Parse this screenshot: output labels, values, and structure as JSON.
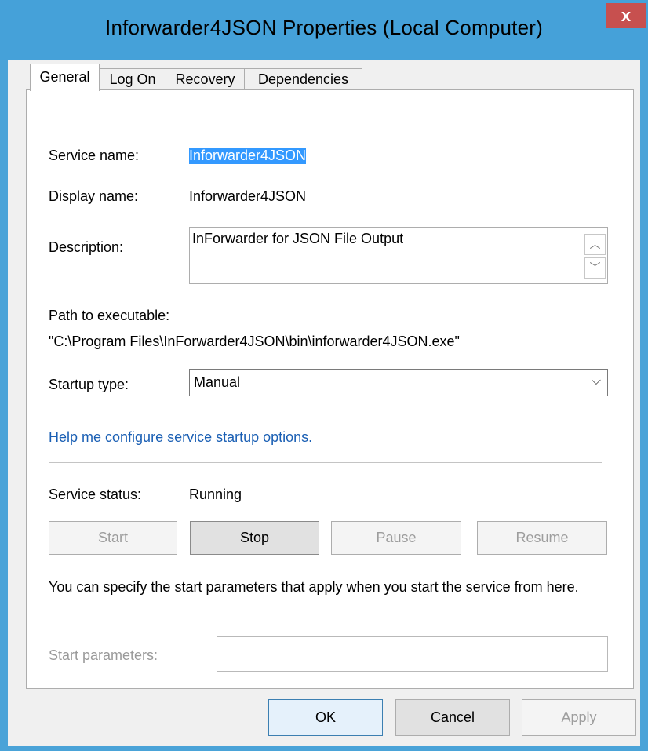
{
  "window": {
    "title": "Inforwarder4JSON Properties (Local Computer)",
    "close_label": "x"
  },
  "tabs": [
    {
      "label": "General",
      "active": true
    },
    {
      "label": "Log On",
      "active": false
    },
    {
      "label": "Recovery",
      "active": false
    },
    {
      "label": "Dependencies",
      "active": false
    }
  ],
  "general": {
    "service_name_label": "Service name:",
    "service_name_value": "Inforwarder4JSON",
    "display_name_label": "Display name:",
    "display_name_value": "Inforwarder4JSON",
    "description_label": "Description:",
    "description_value": "InForwarder for JSON File Output",
    "path_label": "Path to executable:",
    "path_value": "\"C:\\Program Files\\InForwarder4JSON\\bin\\inforwarder4JSON.exe\"",
    "startup_type_label": "Startup type:",
    "startup_type_value": "Manual",
    "help_link": "Help me configure service startup options.",
    "status_label": "Service status:",
    "status_value": "Running",
    "buttons": {
      "start": "Start",
      "stop": "Stop",
      "pause": "Pause",
      "resume": "Resume"
    },
    "start_params_note": "You can specify the start parameters that apply when you start the service from here.",
    "start_params_label": "Start parameters:",
    "start_params_value": ""
  },
  "footer": {
    "ok": "OK",
    "cancel": "Cancel",
    "apply": "Apply"
  },
  "colors": {
    "title_bar": "#45a1d9",
    "close_button": "#c7504f",
    "selection": "#3399ff",
    "link": "#1a5fb4"
  }
}
